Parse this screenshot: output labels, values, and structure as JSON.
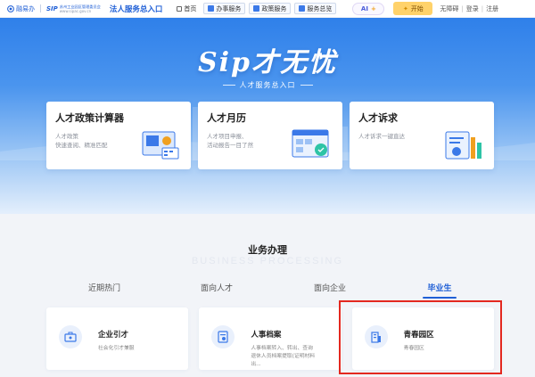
{
  "header": {
    "brand_left": "融易办",
    "brand_right_mark": "SIP",
    "brand_right_org": "苏州工业园区管理委员会",
    "brand_right_url": "www.sipac.gov.cn",
    "portal_title": "法人服务总入口",
    "nav": [
      {
        "label": "首页",
        "icon": "home-icon"
      },
      {
        "label": "办事服务",
        "icon": "service-icon"
      },
      {
        "label": "政策服务",
        "icon": "policy-icon"
      },
      {
        "label": "服务总览",
        "icon": "overview-icon"
      }
    ],
    "ai_label": "AI",
    "ai_plus": "+",
    "start_label": "开始",
    "accessibility": "无障碍",
    "login": "登录",
    "register": "注册"
  },
  "hero": {
    "title": "Sip才无忧",
    "subtitle": "人才服务总入口",
    "cards": [
      {
        "title": "人才政策计算器",
        "desc1": "人才政策",
        "desc2": "快速查阅、精准匹配"
      },
      {
        "title": "人才月历",
        "desc1": "人才项目申报、",
        "desc2": "活动报告一目了然"
      },
      {
        "title": "人才诉求",
        "desc1": "人才诉求一键直达",
        "desc2": ""
      }
    ]
  },
  "section": {
    "title": "业务办理",
    "title_en": "BUSINESS PROCESSING",
    "tabs": [
      {
        "label": "近期热门",
        "active": false
      },
      {
        "label": "面向人才",
        "active": false
      },
      {
        "label": "面向企业",
        "active": false
      },
      {
        "label": "毕业生",
        "active": true
      }
    ],
    "services": [
      {
        "name": "企业引才",
        "desc": "社会化引才兼服"
      },
      {
        "name": "人事档案",
        "desc": "人事档案转入、转出、查询退休人员档案提取(证明材料出..."
      },
      {
        "name": "青春园区",
        "desc": "青春园区"
      }
    ]
  },
  "colors": {
    "brand_blue": "#1f5fd6",
    "highlight_red": "#e3281f",
    "start_yellow": "#ffd26a"
  }
}
